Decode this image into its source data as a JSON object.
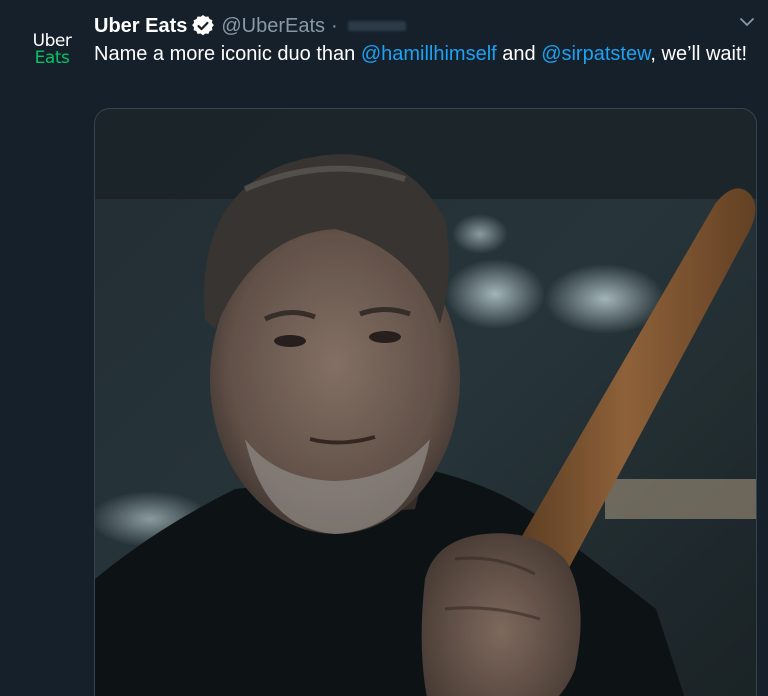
{
  "account": {
    "display_name": "Uber Eats",
    "handle": "@UberEats",
    "separator": "·",
    "avatar_line1": "Uber",
    "avatar_line2": "Eats",
    "verified": true
  },
  "tweet": {
    "text_before": "Name a more iconic duo than ",
    "mention1": "@hamillhimself",
    "text_middle": " and ",
    "mention2": "@sirpatstew",
    "text_after": ", we’ll wait!"
  },
  "colors": {
    "background": "#15202b",
    "text": "#ffffff",
    "secondary": "#8899a6",
    "link": "#1da1f2",
    "brand_green": "#06c167"
  },
  "icons": {
    "verified": "verified-badge-icon",
    "menu": "chevron-down-icon"
  }
}
